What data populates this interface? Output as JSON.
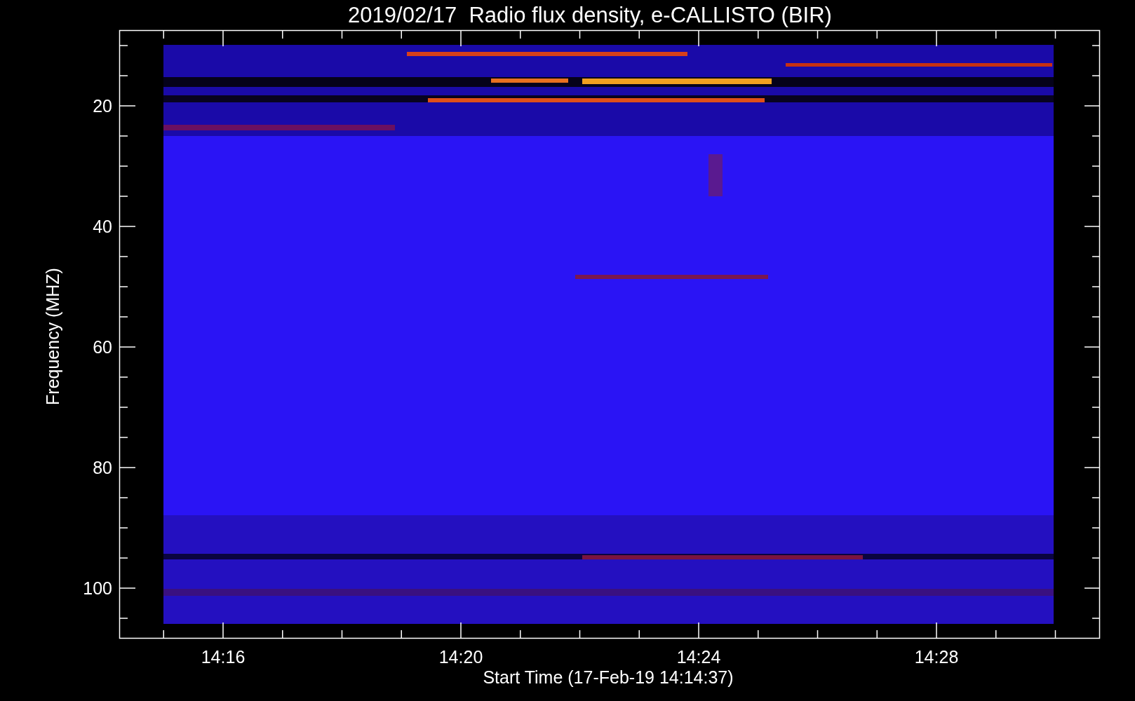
{
  "title": "2019/02/17  Radio flux density, e-CALLISTO (BIR)",
  "y_axis": {
    "label": "Frequency (MHZ)",
    "tick_labels": [
      "20",
      "40",
      "60",
      "80",
      "100"
    ]
  },
  "x_axis": {
    "label": "Start Time (17-Feb-19 14:14:37)",
    "tick_labels": [
      "14:16",
      "14:20",
      "14:24",
      "14:28"
    ]
  }
}
